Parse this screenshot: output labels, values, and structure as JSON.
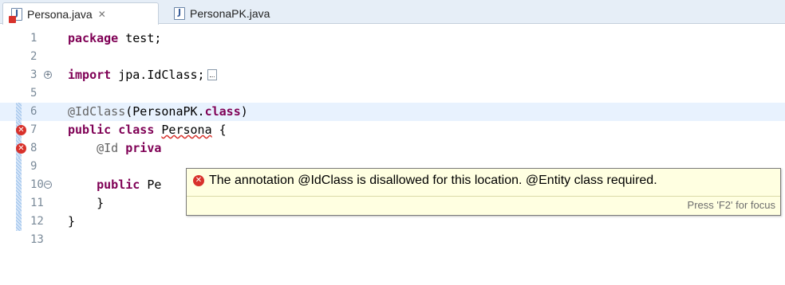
{
  "tabs": [
    {
      "label": "Persona.java",
      "active": true,
      "close_glyph": "✕",
      "has_error": true
    },
    {
      "label": "PersonaPK.java",
      "active": false
    }
  ],
  "editor": {
    "lines": [
      {
        "no": "1",
        "code": [
          {
            "t": "package",
            "c": "kw"
          },
          {
            "t": " test;"
          }
        ]
      },
      {
        "no": "2",
        "code": []
      },
      {
        "no": "3",
        "fold": "+",
        "code": [
          {
            "t": "import",
            "c": "kw"
          },
          {
            "t": " jpa.IdClass;"
          }
        ],
        "collapsed": true
      },
      {
        "no": "5",
        "code": []
      },
      {
        "no": "6",
        "code": [
          {
            "t": "@IdClass",
            "c": "ann"
          },
          {
            "t": "(PersonaPK."
          },
          {
            "t": "class",
            "c": "kw"
          },
          {
            "t": ")"
          }
        ],
        "highlight": true
      },
      {
        "no": "7",
        "error": true,
        "code": [
          {
            "t": "public",
            "c": "kw"
          },
          {
            "t": " "
          },
          {
            "t": "class",
            "c": "kw"
          },
          {
            "t": " "
          },
          {
            "t": "Persona",
            "c": "squiggle"
          },
          {
            "t": " {"
          }
        ]
      },
      {
        "no": "8",
        "error": true,
        "code": [
          {
            "t": "    "
          },
          {
            "t": "@Id",
            "c": "ann"
          },
          {
            "t": " "
          },
          {
            "t": "priva",
            "c": "kw"
          }
        ]
      },
      {
        "no": "9",
        "code": []
      },
      {
        "no": "10",
        "fold": "−",
        "code": [
          {
            "t": "    "
          },
          {
            "t": "public",
            "c": "kw"
          },
          {
            "t": " Pe"
          }
        ]
      },
      {
        "no": "11",
        "code": [
          {
            "t": "    }"
          }
        ]
      },
      {
        "no": "12",
        "code": [
          {
            "t": "}"
          }
        ]
      },
      {
        "no": "13",
        "code": []
      }
    ],
    "ruler_marks": [
      "6",
      "7",
      "8",
      "9",
      "10",
      "11",
      "12"
    ]
  },
  "popup": {
    "message": "The annotation @IdClass is disallowed for this location. @Entity class required.",
    "status": "Press 'F2' for focus"
  },
  "colors": {
    "keyword": "#7f0055",
    "annotation": "#646464",
    "error": "#d8322c",
    "popup_bg": "#ffffe1",
    "highlight_line": "#e8f2fe"
  }
}
